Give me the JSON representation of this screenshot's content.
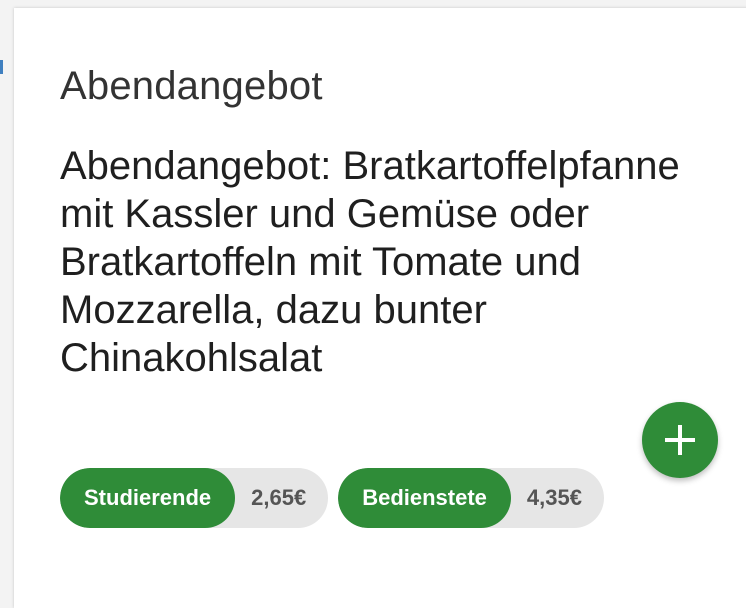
{
  "card": {
    "category": "Abendangebot",
    "meal": "Abendangebot: Bratkartoffelpfanne mit Kassler und Gemüse oder Bratkartoffeln mit Tomate und Mozzarella, dazu bunter Chinakohlsalat",
    "add_icon": "plus-icon",
    "prices": [
      {
        "group": "Studierende",
        "price": "2,65€"
      },
      {
        "group": "Bedienstete",
        "price": "4,35€"
      }
    ]
  },
  "colors": {
    "accent": "#2f8c38",
    "chip_bg": "#e6e6e6",
    "text": "#1f1f1f"
  }
}
